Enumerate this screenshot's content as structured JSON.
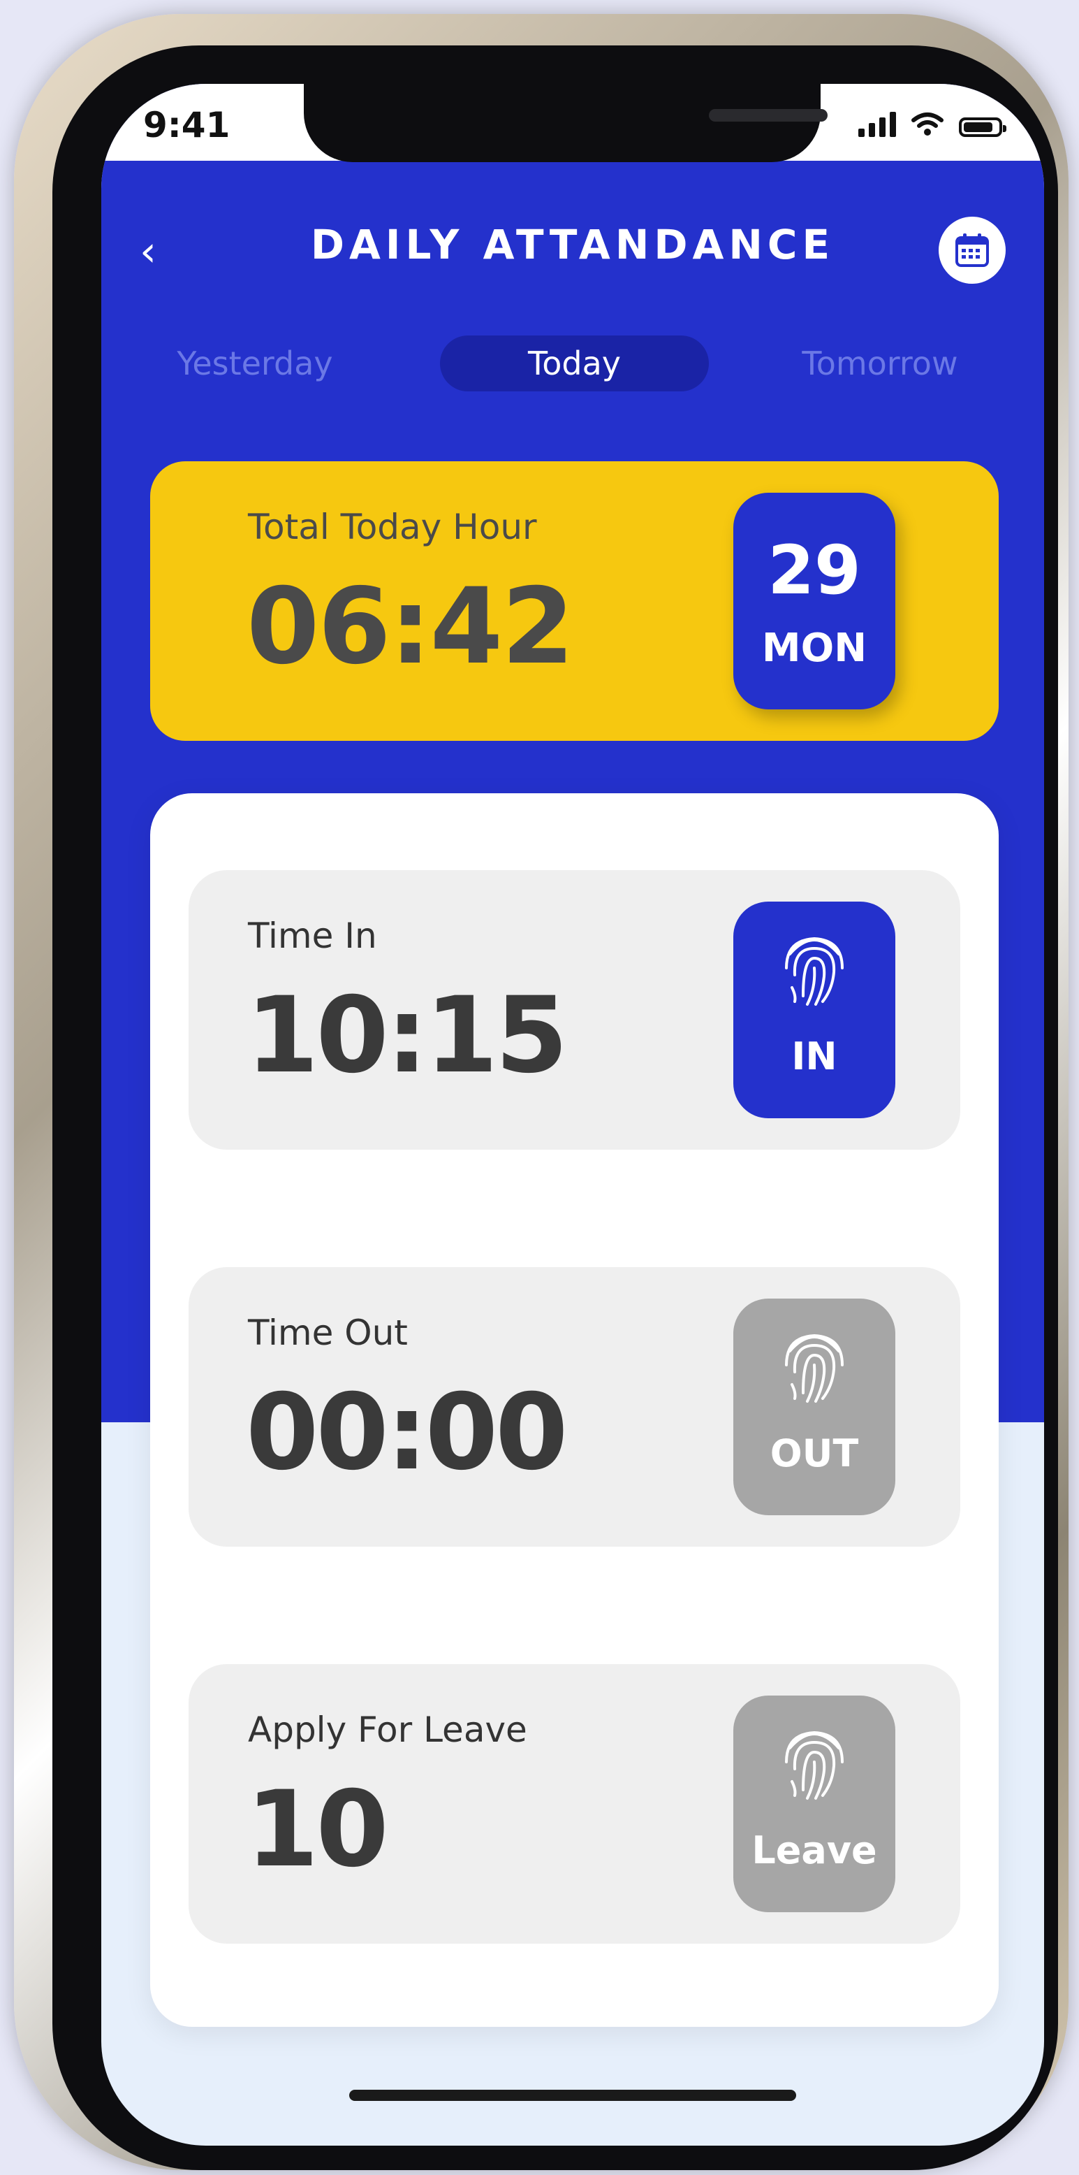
{
  "status_bar": {
    "time": "9:41"
  },
  "header": {
    "title": "DAILY ATTANDANCE"
  },
  "tabs": [
    {
      "label": "Yesterday",
      "selected": false
    },
    {
      "label": "Today",
      "selected": true
    },
    {
      "label": "Tomorrow",
      "selected": false
    }
  ],
  "summary": {
    "label": "Total Today Hour",
    "value": "06:42",
    "date_day": "29",
    "date_weekday": "MON"
  },
  "entries": [
    {
      "label": "Time In",
      "value": "10:15",
      "button": "IN",
      "active": true
    },
    {
      "label": "Time Out",
      "value": "00:00",
      "button": "OUT",
      "active": false
    },
    {
      "label": "Apply For Leave",
      "value": "10",
      "button": "Leave",
      "active": false
    }
  ],
  "colors": {
    "primary": "#2431cc",
    "accent_yellow": "#f6c810",
    "disabled": "#a6a6a6",
    "card": "#efefef"
  }
}
